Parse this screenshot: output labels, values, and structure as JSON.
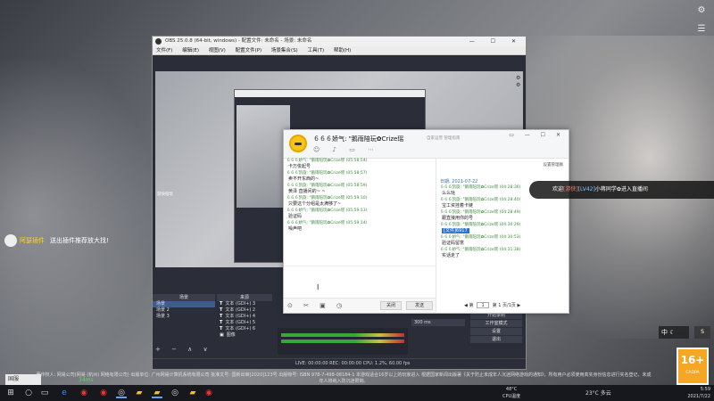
{
  "obs": {
    "title": "OBS 25.0.8 (64-bit, windows) - 配置文件: 未命名 - 场景: 未命名",
    "menu": [
      "文件(F)",
      "编辑(E)",
      "视图(V)",
      "配置文件(P)",
      "场景集合(S)",
      "工具(T)",
      "帮助(H)"
    ],
    "scenes_header": "场景",
    "sources_header": "来源",
    "scenes": [
      "场景",
      "场景 2",
      "场景 3"
    ],
    "sources": [
      "文本 (GDI+) 3",
      "文本 (GDI+) 2",
      "文本 (GDI+) 4",
      "文本 (GDI+) 5",
      "文本 (GDI+) 6",
      "图像"
    ],
    "controls": [
      "开始录制",
      "工作室模式",
      "设置",
      "退出"
    ],
    "audio_value": "300 ms",
    "status": "LIVE: 00:00:00   REC: 00:00:00   CPU: 1.2%, 60.00 fps"
  },
  "chat": {
    "title": "６６６娇气: \"鹅雨陪玩✿Crize瑶",
    "subtitle": "自家运营 管理指南",
    "group_manage": "设置管理群",
    "date": "日期: 2021-07-22",
    "messages_left": [
      {
        "who": "６６６娇气: \"鹅雨陪玩✿Crize瑶",
        "time": "(05:58:54)",
        "text": "卡万俊起号"
      },
      {
        "who": "６６６凯旋: \"鹅雨陪玩✿Crize瑶",
        "time": "(05:58:57)",
        "text": "卖不开东西的~"
      },
      {
        "who": "６６６凯旋: \"鹅雨陪玩✿Crize瑶",
        "time": "(05:58:59)",
        "text": "黄泽 直播间的~ ~"
      },
      {
        "who": "６６６凯旋: \"鹅雨陪玩✿Crize瑶",
        "time": "(05:59:10)",
        "text": "只要这个分组是太满够了~"
      },
      {
        "who": "６６６娇气: \"鹅雨陪玩✿Crize瑶",
        "time": "(05:59:13)",
        "text": "验证码"
      },
      {
        "who": "６６６娇气: \"鹅雨陪玩✿Crize瑶",
        "time": "(05:59:14)",
        "text": "噪声吧"
      }
    ],
    "messages_right": [
      {
        "who": "６６６凯旋: \"鹅雨陪玩✿Crize瑶",
        "time": "(04:28:36)",
        "text": "么么哒"
      },
      {
        "who": "６６６凯旋: \"鹅雨陪玩✿Crize瑶",
        "time": "(04:28:40)",
        "text": "宝工资挂着卡链"
      },
      {
        "who": "６６６凯旋: \"鹅雨陪玩✿Crize瑶",
        "time": "(04:28:49)",
        "text": "跟直接用你的号"
      },
      {
        "who": "６６６凯旋: \"鹅雨陪玩✿Crize瑶",
        "time": "(04:30:29)",
        "text": "[文件]6917"
      },
      {
        "who": "６６６娇气: \"鹅雨陪玩✿Crize瑶",
        "time": "(04:30:53)",
        "text": "验证码留意"
      },
      {
        "who": "６６６娇气: \"鹅雨陪玩✿Crize瑶",
        "time": "(04:31:38)",
        "text": "实话走了"
      }
    ],
    "btn_close": "关闭",
    "btn_send": "发送",
    "pager_page": "1",
    "pager_total": "第 1 页/1页",
    "pager_label": "第"
  },
  "overlay": {
    "enter_prefix": "欢迎",
    "enter_badge1": "[游侠]",
    "enter_badge2": "[LV42]",
    "enter_text": "小蒋同学✿进入直播间",
    "gift_name": "阿瑟插件",
    "gift_text": "送出插件推荐放大找!",
    "home_tag": "国服",
    "speed": "34ms",
    "copyright": "著作权人: 网易公司(网易 (杭州) 网络有限公司) 出版单位: 广州网易计算机系统有限公司 批准文号: 国新出审[2020]123号 出版物号: ISBN 978-7-498-08184-1 本游戏适合16岁以上的玩家进入 根据国家新闻出版署《关于防止未成年人沉迷网络游戏的通知》，所有用户必须使用真实身份信息进行实名登记，未成年人将纳入防沉迷限制。",
    "rating": "16+",
    "rating_sub": "CADPA",
    "ime": "中",
    "small_web": "游侠陪玩"
  },
  "taskbar": {
    "weather": "23°C 多云",
    "cpu_top": "48°C",
    "cpu_bottom": "CPU温度",
    "time": "5:59",
    "date": "2021/7/22"
  }
}
